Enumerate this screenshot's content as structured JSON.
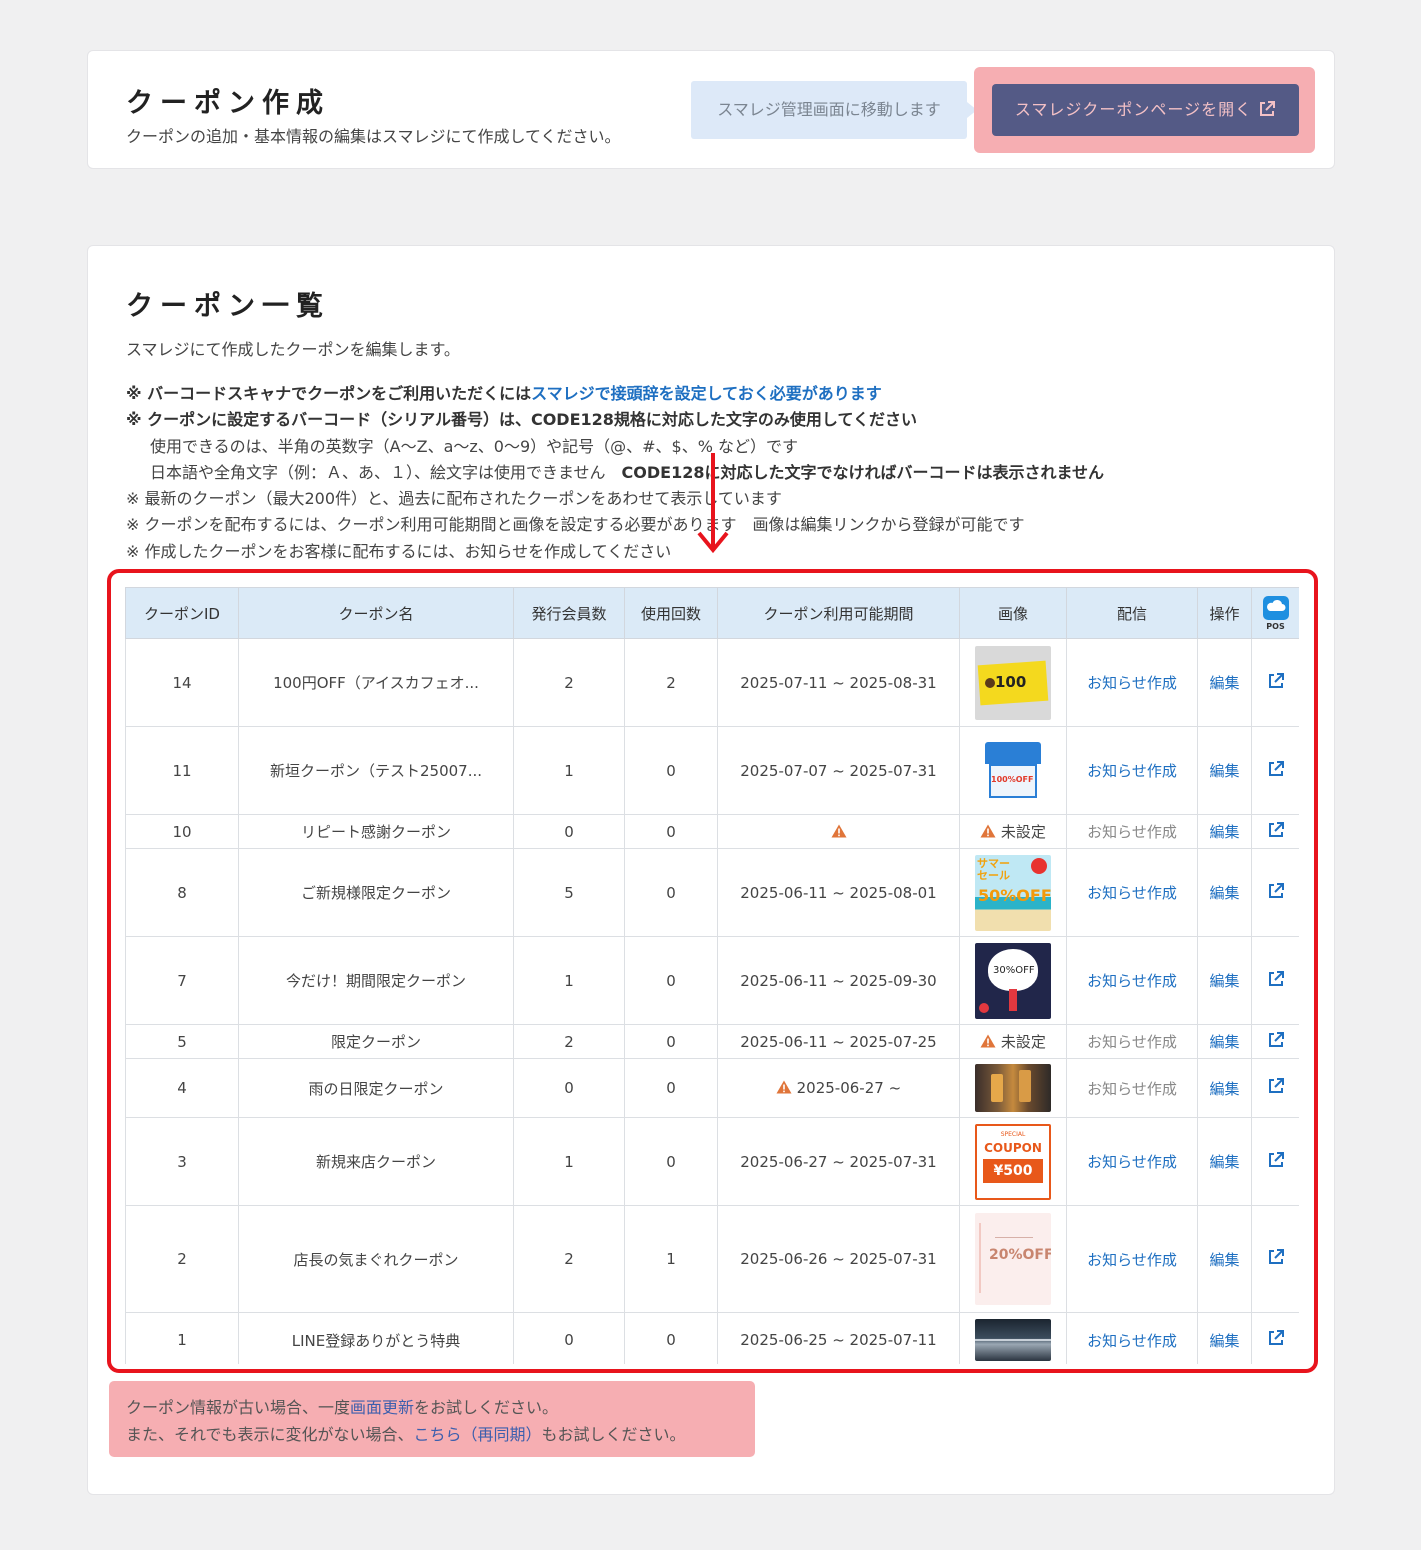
{
  "create": {
    "title": "クーポン作成",
    "description": "クーポンの追加・基本情報の編集はスマレジにて作成してください。",
    "move_hint": "スマレジ管理画面に移動します",
    "open_button": "スマレジクーポンページを開く"
  },
  "list": {
    "title": "クーポン一覧",
    "description": "スマレジにて作成したクーポンを編集します。",
    "notes": {
      "n1_prefix": "※ バーコードスキャナでクーポンをご利用いただくには",
      "n1_link": "スマレジで接頭辞を設定しておく必要があります",
      "n2": "※ クーポンに設定するバーコード（シリアル番号）は、CODE128規格に対応した文字のみ使用してください",
      "n3": "使用できるのは、半角の英数字（A〜Z、a〜z、0〜9）や記号（@、#、$、% など）です",
      "n4a": "日本語や全角文字（例：Ａ、あ、１）、絵文字は使用できません",
      "n4b": "CODE128に対応した文字でなければバーコードは表示されません",
      "n5": "※ 最新のクーポン（最大200件）と、過去に配布されたクーポンをあわせて表示しています",
      "n6": "※ クーポンを配布するには、クーポン利用可能期間と画像を設定する必要があります　画像は編集リンクから登録が可能です",
      "n7": "※ 作成したクーポンをお客様に配布するには、お知らせを作成してください"
    },
    "columns": [
      "クーポンID",
      "クーポン名",
      "発行会員数",
      "使用回数",
      "クーポン利用可能期間",
      "画像",
      "配信",
      "操作"
    ],
    "pos_label": "POS",
    "rows": [
      {
        "id": "14",
        "name": "100円OFF（アイスカフェオ...",
        "members": "2",
        "uses": "2",
        "period": "2025-07-11 ~ 2025-08-31",
        "period_warn": false,
        "image": "yellow-100off",
        "image_label": "100",
        "notice": "お知らせ作成",
        "notice_enabled": true,
        "edit": "編集"
      },
      {
        "id": "11",
        "name": "新垣クーポン（テスト25007...",
        "members": "1",
        "uses": "0",
        "period": "2025-07-07 ~ 2025-07-31",
        "period_warn": false,
        "image": "shop-100off",
        "image_label": "100%OFF",
        "notice": "お知らせ作成",
        "notice_enabled": true,
        "edit": "編集"
      },
      {
        "id": "10",
        "name": "リピート感謝クーポン",
        "members": "0",
        "uses": "0",
        "period": "",
        "period_warn": true,
        "image": "none",
        "image_label": "未設定",
        "notice": "お知らせ作成",
        "notice_enabled": false,
        "edit": "編集"
      },
      {
        "id": "8",
        "name": "ご新規様限定クーポン",
        "members": "5",
        "uses": "0",
        "period": "2025-06-11 ~ 2025-08-01",
        "period_warn": false,
        "image": "summer-sale",
        "image_label": "サマーセール 50%OFF",
        "notice": "お知らせ作成",
        "notice_enabled": true,
        "edit": "編集"
      },
      {
        "id": "7",
        "name": "今だけ！期間限定クーポン",
        "members": "1",
        "uses": "0",
        "period": "2025-06-11 ~ 2025-09-30",
        "period_warn": false,
        "image": "fathers-day",
        "image_label": "30%OFF",
        "notice": "お知らせ作成",
        "notice_enabled": true,
        "edit": "編集"
      },
      {
        "id": "5",
        "name": "限定クーポン",
        "members": "2",
        "uses": "0",
        "period": "2025-06-11 ~ 2025-07-25",
        "period_warn": false,
        "image": "none",
        "image_label": "未設定",
        "notice": "お知らせ作成",
        "notice_enabled": false,
        "edit": "編集"
      },
      {
        "id": "4",
        "name": "雨の日限定クーポン",
        "members": "0",
        "uses": "0",
        "period": "2025-06-27 ~",
        "period_warn": true,
        "image": "drinks-photo",
        "image_label": "",
        "notice": "お知らせ作成",
        "notice_enabled": false,
        "edit": "編集"
      },
      {
        "id": "3",
        "name": "新規来店クーポン",
        "members": "1",
        "uses": "0",
        "period": "2025-06-27 ~ 2025-07-31",
        "period_warn": false,
        "image": "coupon-500",
        "image_label": "COUPON ¥500",
        "notice": "お知らせ作成",
        "notice_enabled": true,
        "edit": "編集"
      },
      {
        "id": "2",
        "name": "店長の気まぐれクーポン",
        "members": "2",
        "uses": "1",
        "period": "2025-06-26 ~ 2025-07-31",
        "period_warn": false,
        "image": "pink-20off",
        "image_label": "20%OFF",
        "notice": "お知らせ作成",
        "notice_enabled": true,
        "edit": "編集"
      },
      {
        "id": "1",
        "name": "LINE登録ありがとう特典",
        "members": "0",
        "uses": "0",
        "period": "2025-06-25 ~ 2025-07-11",
        "period_warn": false,
        "image": "car-photo",
        "image_label": "",
        "notice": "お知らせ作成",
        "notice_enabled": true,
        "edit": "編集"
      }
    ]
  },
  "refresh": {
    "line1_prefix": "クーポン情報が古い場合、一度",
    "line1_link": "画面更新",
    "line1_suffix": "をお試しください。",
    "line2_prefix": "また、それでも表示に変化がない場合、",
    "line2_link": "こちら（再同期）",
    "line2_suffix": "もお試しください。"
  },
  "colors": {
    "accent_link": "#1e6fc1",
    "highlight_red": "#e8141d",
    "header_blue": "#dbeaf7",
    "button_bg": "#545a86",
    "warning_orange": "#e0753a"
  }
}
